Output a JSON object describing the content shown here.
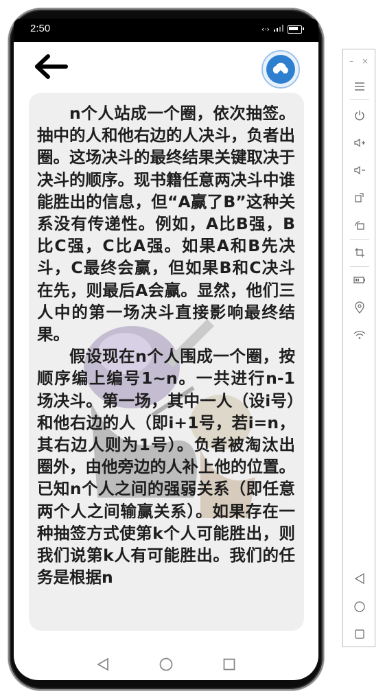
{
  "status_bar": {
    "time": "2:50"
  },
  "header": {
    "back_icon": "arrow-left-icon",
    "logo_icon": "cloud-house-logo"
  },
  "content": {
    "paragraphs": [
      "n个人站成一个圈，依次抽签。抽中的人和他右边的人决斗，负者出圈。这场决斗的最终结果关键取决于决斗的顺序。现书籍任意两决斗中谁能胜出的信息，但“A赢了B”这种关系没有传递性。例如，A比B强，B比C强，C比A强。如果A和B先决斗，C最终会赢，但如果B和C决斗在先，则最后A会赢。显然，他们三人中的第一场决斗直接影响最终结果。",
      "假设现在n个人围成一个圈，按顺序编上编号1~n。一共进行n-1场决斗。第一场，其中一人（设i号）和他右边的人（即i+1号，若i=n，其右边人则为1号）。负者被淘汰出圈外，由他旁边的人补上他的位置。已知n个人之间的强弱关系（即任意两个人之间输赢关系）。如果存在一种抽签方式使第k个人可能胜出，则我们说第k人有可能胜出。我们的任务是根据n"
    ]
  },
  "nav_bar": {
    "icons": [
      "nav-back-icon",
      "nav-home-icon",
      "nav-recents-icon"
    ]
  },
  "emulator_toolbar": {
    "window_buttons": [
      "–",
      "×"
    ],
    "buttons": [
      "menu-icon",
      "power-icon",
      "volume-up-icon",
      "volume-down-icon",
      "rotate-icon",
      "rotate-screen-icon",
      "crop-icon",
      "battery-icon",
      "location-icon",
      "wifi-icon",
      "back-icon",
      "home-icon",
      "recents-icon"
    ]
  },
  "colors": {
    "card_bg": "#efefef",
    "text": "#1e1e1e",
    "logo_blue": "#2f7fd0"
  }
}
